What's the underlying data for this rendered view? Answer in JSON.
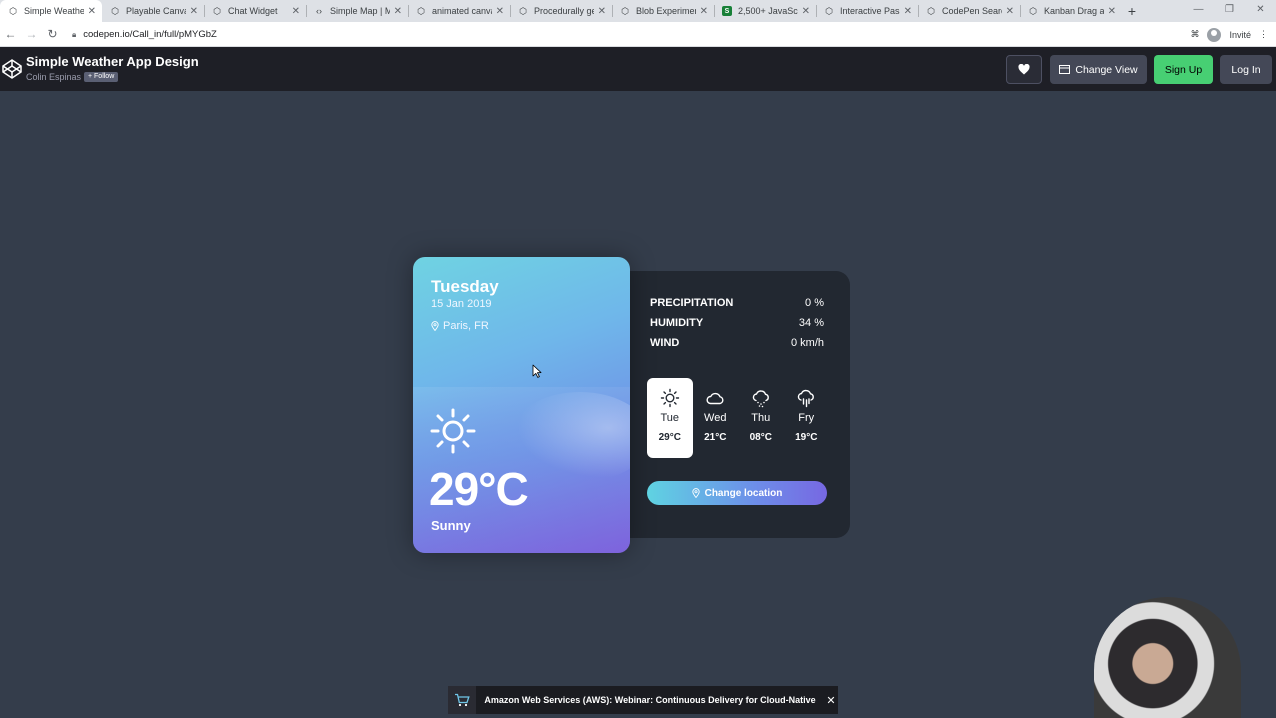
{
  "browser": {
    "tabs": [
      {
        "title": "Simple Weather",
        "icon": "codepen-icon",
        "active": true
      },
      {
        "title": "Playable Canvas",
        "icon": "codepen-icon"
      },
      {
        "title": "Chat Widget",
        "icon": "codepen-icon"
      },
      {
        "title": "Simple Map | M",
        "icon": "code-icon"
      },
      {
        "title": "animated canva",
        "icon": "codepen-icon"
      },
      {
        "title": "Procedurally ge",
        "icon": "codepen-icon"
      },
      {
        "title": "Blob Experiment",
        "icon": "codepen-icon"
      },
      {
        "title": "2,500+ JavaScri",
        "icon": "sheet-icon"
      },
      {
        "title": "Interactive Pass",
        "icon": "codepen-icon"
      },
      {
        "title": "CodePen Search",
        "icon": "codepen-icon"
      },
      {
        "title": "Kanban Drag an",
        "icon": "codepen-icon"
      }
    ],
    "url": "codepen.io/Call_in/full/pMYGbZ",
    "profile_label": "Invité"
  },
  "header": {
    "title": "Simple Weather App Design",
    "author": "Colin Espinas",
    "follow_label": "+ Follow",
    "change_view_label": "Change View",
    "signup_label": "Sign Up",
    "login_label": "Log In"
  },
  "weather": {
    "day": "Tuesday",
    "date": "15 Jan 2019",
    "location": "Paris, FR",
    "temperature": "29°C",
    "condition": "Sunny",
    "stats": [
      {
        "label": "PRECIPITATION",
        "value": "0 %"
      },
      {
        "label": "HUMIDITY",
        "value": "34 %"
      },
      {
        "label": "WIND",
        "value": "0 km/h"
      }
    ],
    "week": [
      {
        "day": "Tue",
        "temp": "29°C",
        "icon": "sun-icon",
        "active": true
      },
      {
        "day": "Wed",
        "temp": "21°C",
        "icon": "cloud-icon"
      },
      {
        "day": "Thu",
        "temp": "08°C",
        "icon": "cloud-drizzle-icon"
      },
      {
        "day": "Fry",
        "temp": "19°C",
        "icon": "cloud-rain-icon"
      }
    ],
    "change_location_label": "Change location"
  },
  "ad": {
    "text": "Amazon Web Services (AWS): Webinar: Continuous Delivery for Cloud-Native"
  },
  "colors": {
    "page_bg": "#343d4b",
    "panel_bg": "#222831",
    "signup_green": "#47cf73",
    "card_gradient_start": "#6fd3e2",
    "card_gradient_end": "#7a62dd"
  }
}
